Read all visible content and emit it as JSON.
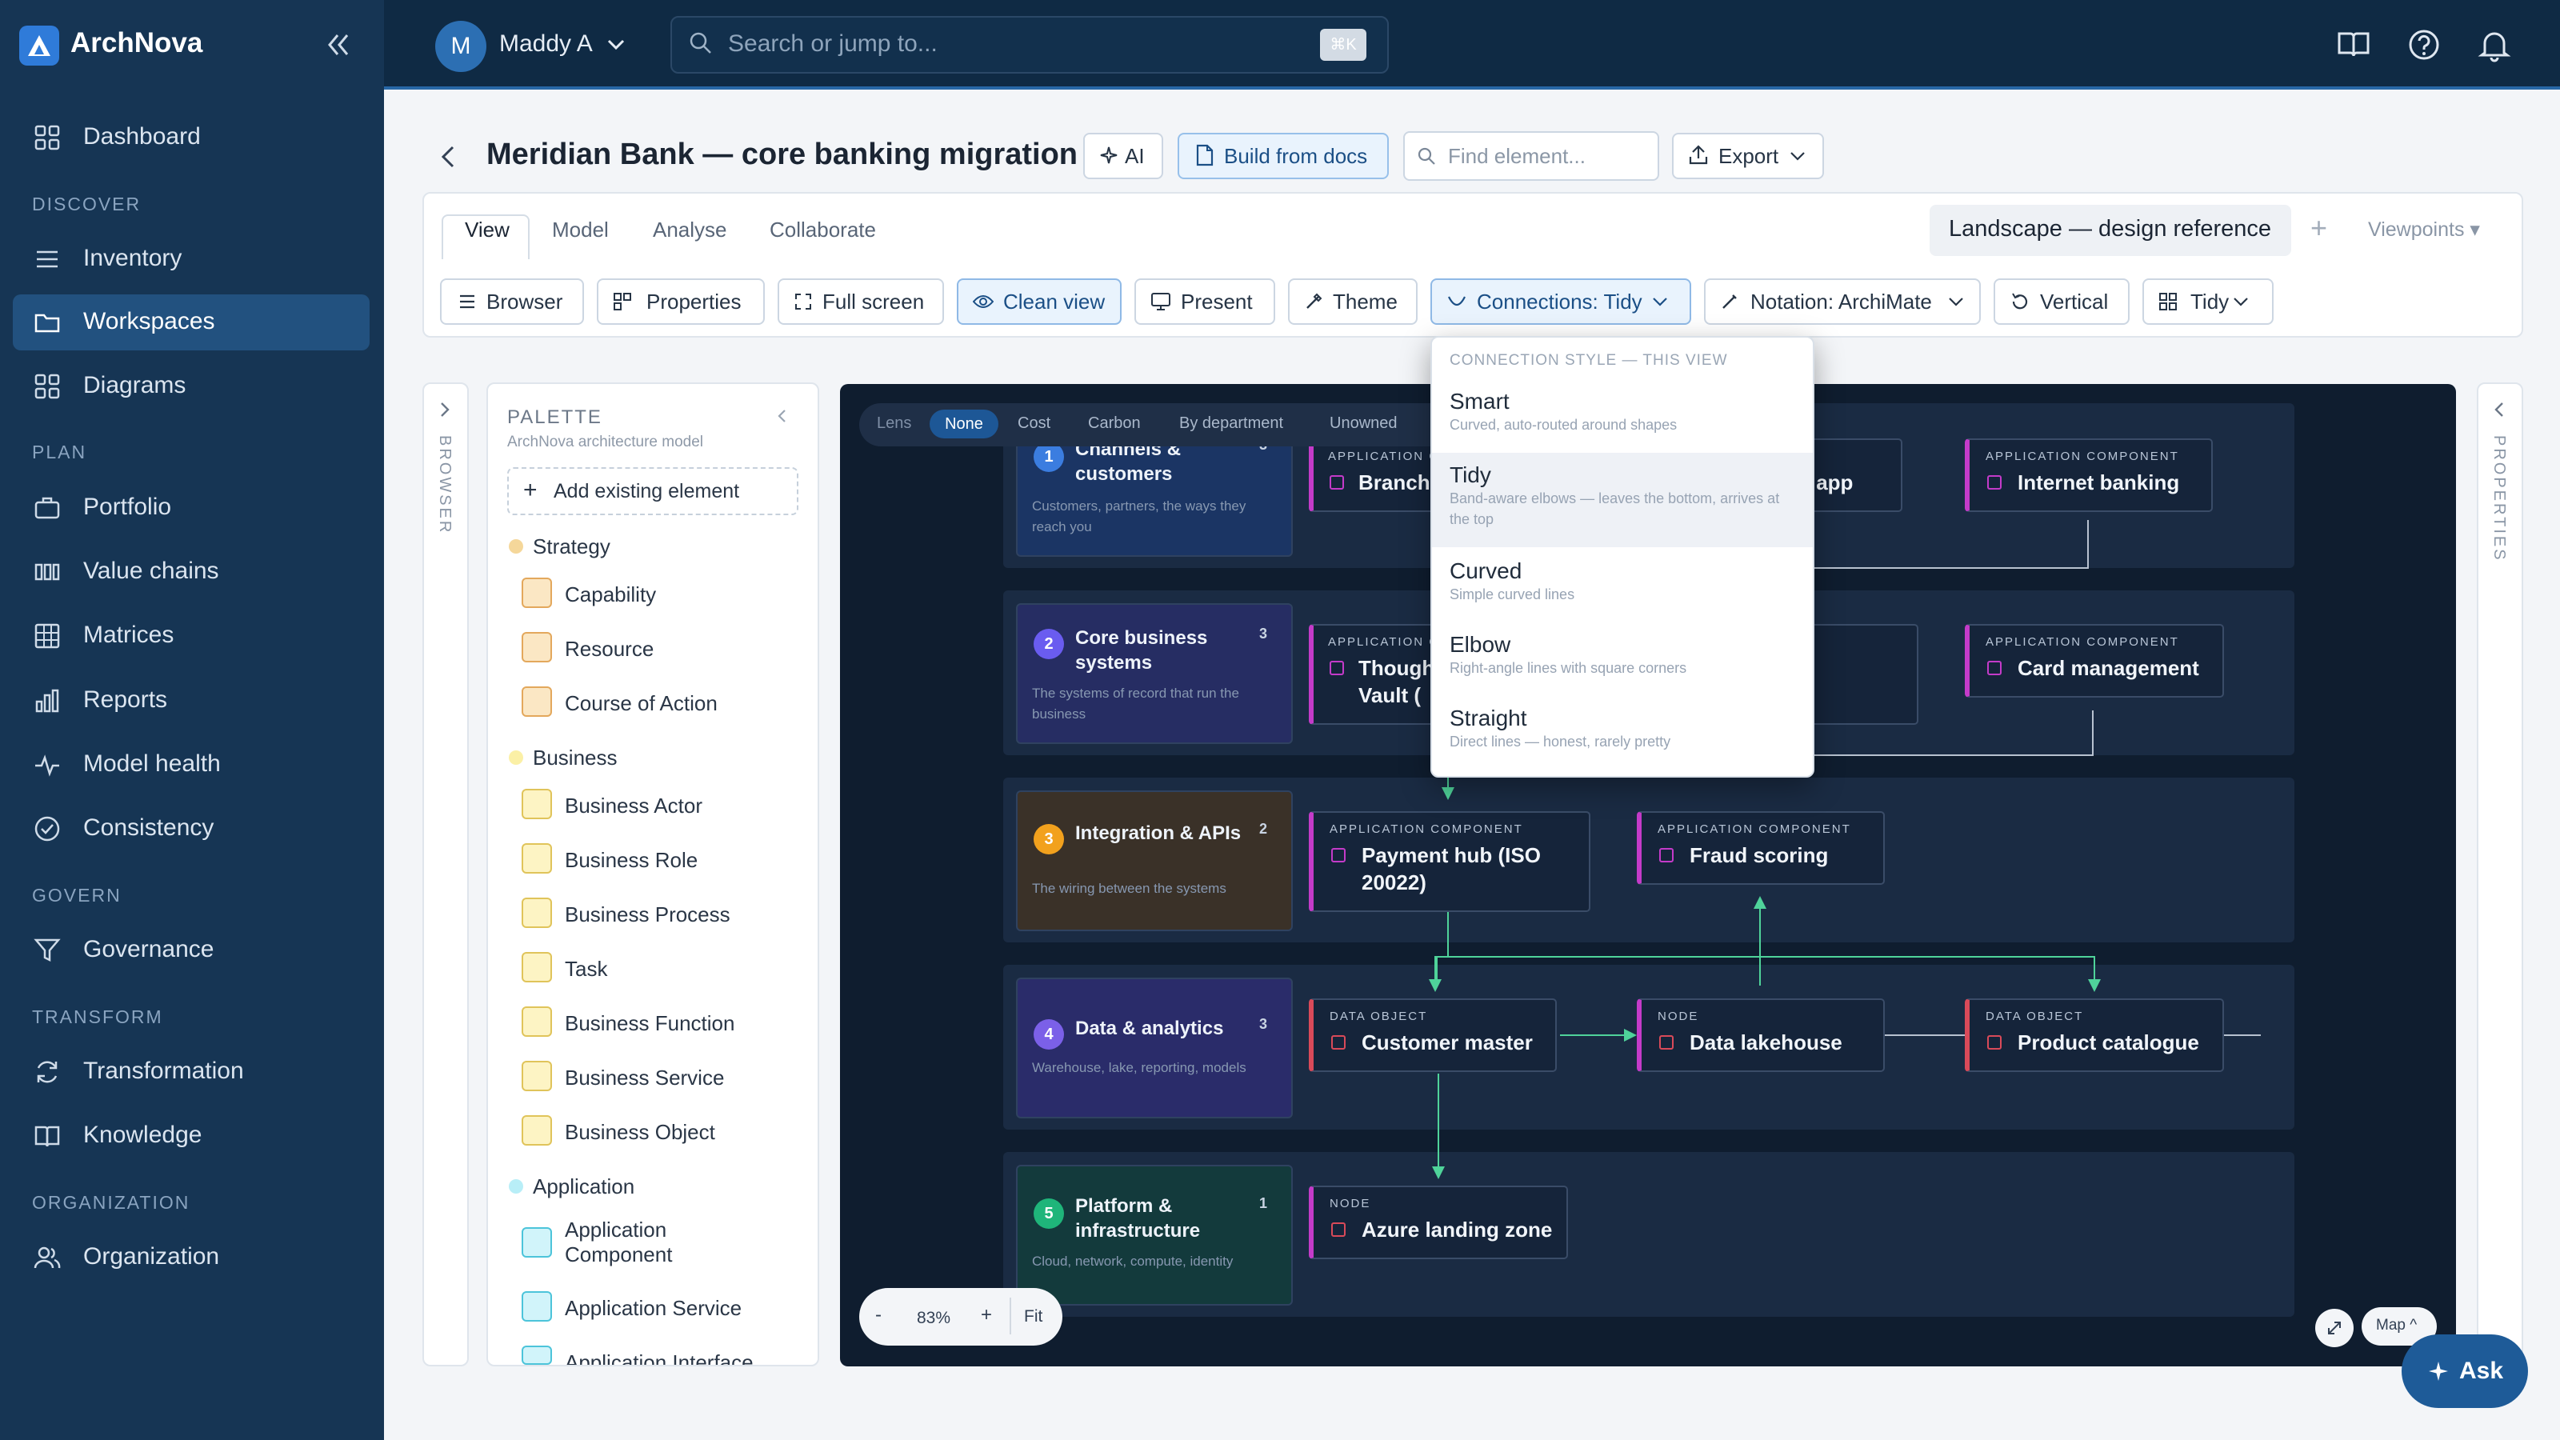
{
  "app": {
    "name": "ArchNova"
  },
  "user": {
    "initial": "M",
    "name": "Maddy A"
  },
  "search": {
    "placeholder": "Search or jump to...",
    "shortcut": "⌘K"
  },
  "sidebar": {
    "dashboard": "Dashboard",
    "sections": [
      "DISCOVER",
      "PLAN",
      "GOVERN",
      "TRANSFORM",
      "ORGANIZATION"
    ],
    "items": [
      {
        "label": "Inventory"
      },
      {
        "label": "Workspaces",
        "active": true
      },
      {
        "label": "Diagrams"
      },
      {
        "label": "Portfolio"
      },
      {
        "label": "Value chains"
      },
      {
        "label": "Matrices"
      },
      {
        "label": "Reports"
      },
      {
        "label": "Model health"
      },
      {
        "label": "Consistency"
      },
      {
        "label": "Governance"
      },
      {
        "label": "Transformation"
      },
      {
        "label": "Knowledge"
      },
      {
        "label": "Organization"
      }
    ]
  },
  "header": {
    "title": "Meridian Bank — core banking migration",
    "ai_label": "AI",
    "build_label": "Build from docs",
    "find_placeholder": "Find element...",
    "export_label": "Export"
  },
  "tabs": [
    "View",
    "Model",
    "Analyse",
    "Collaborate"
  ],
  "viewpoint": {
    "current": "Landscape — design reference",
    "add": "+",
    "viewpoints_label": "Viewpoints ▾"
  },
  "toolbar": {
    "browser": "Browser",
    "properties": "Properties",
    "fullscreen": "Full screen",
    "clean_view": "Clean view",
    "present": "Present",
    "theme": "Theme",
    "connections": "Connections: Tidy",
    "notation": "Notation: ArchiMate",
    "vertical": "Vertical",
    "tidy": "Tidy"
  },
  "rails": {
    "left": "BROWSER",
    "right": "PROPERTIES"
  },
  "palette": {
    "title": "PALETTE",
    "subtitle": "ArchNova architecture model",
    "add_existing": "Add existing element",
    "groups": [
      {
        "name": "Strategy",
        "items": [
          "Capability",
          "Resource",
          "Course of Action"
        ]
      },
      {
        "name": "Business",
        "items": [
          "Business Actor",
          "Business Role",
          "Business Process",
          "Task",
          "Business Function",
          "Business Service",
          "Business Object"
        ]
      },
      {
        "name": "Application",
        "items": [
          "Application Component",
          "Application Service",
          "Application Interface"
        ]
      }
    ]
  },
  "lens": {
    "label": "Lens",
    "options": [
      "None",
      "Cost",
      "Carbon",
      "By department",
      "Unowned"
    ],
    "selected": "None"
  },
  "capabilities": [
    {
      "num": "1",
      "title": "Channels & customers",
      "count": "3",
      "desc": "Customers, partners, the ways they reach you"
    },
    {
      "num": "2",
      "title": "Core business systems",
      "count": "3",
      "desc": "The systems of record that run the business"
    },
    {
      "num": "3",
      "title": "Integration & APIs",
      "count": "2",
      "desc": "The wiring between the systems"
    },
    {
      "num": "4",
      "title": "Data & analytics",
      "count": "3",
      "desc": "Warehouse, lake, reporting, models"
    },
    {
      "num": "5",
      "title": "Platform & infrastructure",
      "count": "1",
      "desc": "Cloud, network, compute, identity"
    }
  ],
  "elements": {
    "branch": {
      "type": "APPLICATION C",
      "name": "Branch"
    },
    "mobile": {
      "type": "ENT",
      "name": "ing app"
    },
    "internet": {
      "type": "APPLICATION COMPONENT",
      "name": "Internet banking"
    },
    "vault": {
      "type": "APPLICATION C",
      "name": "Though Vault ("
    },
    "core": {
      "type": "ENT",
      "name": "ore"
    },
    "card": {
      "type": "APPLICATION COMPONENT",
      "name": "Card management"
    },
    "payment": {
      "type": "APPLICATION COMPONENT",
      "name": "Payment hub (ISO 20022)"
    },
    "fraud": {
      "type": "APPLICATION COMPONENT",
      "name": "Fraud scoring"
    },
    "customer": {
      "type": "DATA OBJECT",
      "name": "Customer master"
    },
    "lakehouse": {
      "type": "NODE",
      "name": "Data lakehouse"
    },
    "product": {
      "type": "DATA OBJECT",
      "name": "Product catalogue"
    },
    "azure": {
      "type": "NODE",
      "name": "Azure landing zone"
    }
  },
  "connection_menu": {
    "header": "CONNECTION STYLE — THIS VIEW",
    "options": [
      {
        "name": "Smart",
        "desc": "Curved, auto-routed around shapes"
      },
      {
        "name": "Tidy",
        "desc": "Band-aware elbows — leaves the bottom, arrives at the top",
        "selected": true
      },
      {
        "name": "Curved",
        "desc": "Simple curved lines"
      },
      {
        "name": "Elbow",
        "desc": "Right-angle lines with square corners"
      },
      {
        "name": "Straight",
        "desc": "Direct lines — honest, rarely pretty"
      }
    ]
  },
  "zoom": {
    "minus": "-",
    "level": "83%",
    "plus": "+",
    "fit": "Fit"
  },
  "map_label": "Map ^",
  "ask_label": "Ask",
  "colors": {
    "sidebar": "#163554",
    "accent": "#1d5796",
    "canvas": "#0f1d2f",
    "connector": "#4fd39a"
  }
}
